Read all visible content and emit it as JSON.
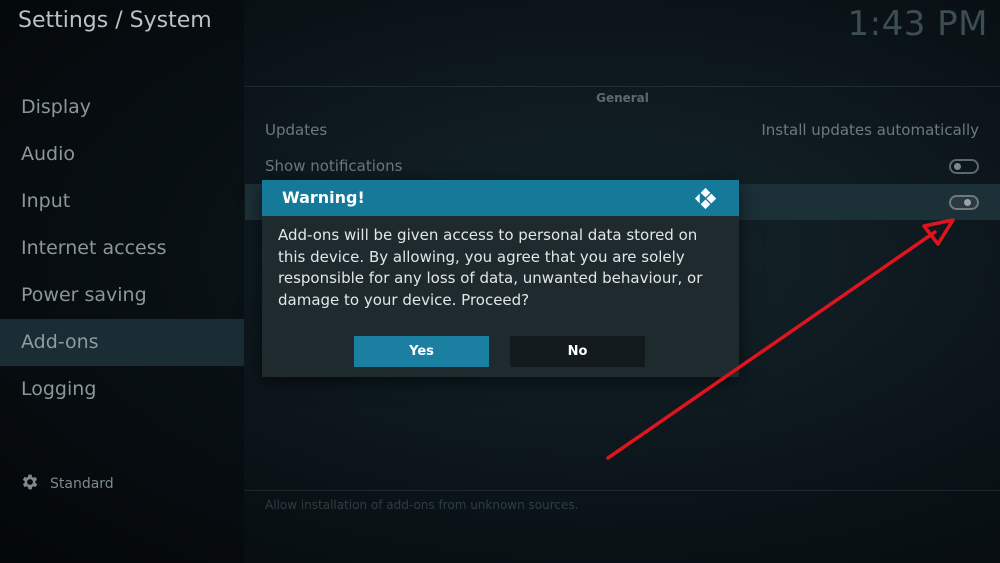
{
  "header": {
    "title": "Settings / System",
    "clock": "1:43 PM"
  },
  "sidebar": {
    "items": [
      {
        "label": "Display"
      },
      {
        "label": "Audio"
      },
      {
        "label": "Input"
      },
      {
        "label": "Internet access"
      },
      {
        "label": "Power saving"
      },
      {
        "label": "Add-ons",
        "active": true
      },
      {
        "label": "Logging"
      }
    ],
    "level_icon": "gear-icon",
    "level_label": "Standard"
  },
  "main": {
    "section_label": "General",
    "rows": [
      {
        "label": "Updates",
        "value": "Install updates automatically"
      },
      {
        "label": "Show notifications",
        "toggle": "off"
      },
      {
        "label": "",
        "toggle": "on",
        "focused": true
      }
    ],
    "help_text": "Allow installation of add-ons from unknown sources."
  },
  "dialog": {
    "title": "Warning!",
    "icon": "kodi-logo-icon",
    "message": "Add-ons will be given access to personal data stored on this device. By allowing, you agree that you are solely responsible for any loss of data, unwanted behaviour, or damage to your device. Proceed?",
    "yes_label": "Yes",
    "no_label": "No"
  },
  "colors": {
    "accent": "#157a9a",
    "annotation_arrow": "#e0141e"
  }
}
